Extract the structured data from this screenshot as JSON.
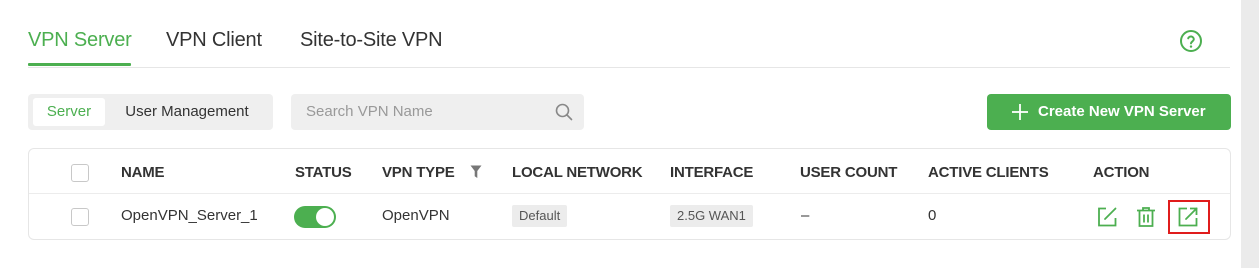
{
  "colors": {
    "accent": "#4caf50",
    "highlight": "#e01c1c"
  },
  "tabs": [
    {
      "label": "VPN Server",
      "active": true
    },
    {
      "label": "VPN Client",
      "active": false
    },
    {
      "label": "Site-to-Site VPN",
      "active": false
    }
  ],
  "toolbar": {
    "segments": [
      {
        "label": "Server",
        "active": true
      },
      {
        "label": "User Management",
        "active": false
      }
    ],
    "search_placeholder": "Search VPN Name",
    "create_label": "Create New VPN Server"
  },
  "table": {
    "columns": [
      "NAME",
      "STATUS",
      "VPN TYPE",
      "LOCAL NETWORK",
      "INTERFACE",
      "USER COUNT",
      "ACTIVE CLIENTS",
      "ACTION"
    ],
    "rows": [
      {
        "name": "OpenVPN_Server_1",
        "status_enabled": true,
        "vpn_type": "OpenVPN",
        "local_network": "Default",
        "interface": "2.5G WAN1",
        "user_count": "–",
        "active_clients": "0",
        "actions": [
          "edit-icon",
          "delete-icon",
          "export-icon"
        ]
      }
    ]
  },
  "icons": [
    "help-icon",
    "search-icon",
    "plus-icon",
    "filter-icon",
    "edit-icon",
    "delete-icon",
    "export-icon"
  ]
}
